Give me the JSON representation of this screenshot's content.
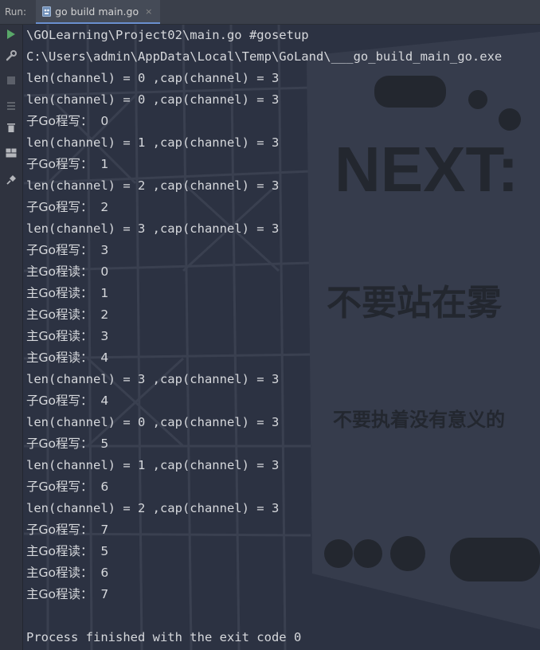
{
  "run_panel": {
    "label": "Run:",
    "tab": {
      "label": "go build main.go",
      "icon": "go-file-icon",
      "close": "×"
    }
  },
  "sidebar": {
    "tools": [
      "run-icon",
      "wrench-icon",
      "stop-icon",
      "sort-icon",
      "trash-icon",
      "layout-icon",
      "pin-icon"
    ]
  },
  "colors": {
    "run_green": "#59a869",
    "text": "#d6d8dc",
    "tab_underline": "#6a8fd0"
  },
  "console": {
    "lines": [
      "\\GOLearning\\Project02\\main.go #gosetup",
      "C:\\Users\\admin\\AppData\\Local\\Temp\\GoLand\\___go_build_main_go.exe",
      "len(channel) = 0 ,cap(channel) = 3",
      "len(channel) = 0 ,cap(channel) = 3",
      "子Go程写：  0",
      "len(channel) = 1 ,cap(channel) = 3",
      "子Go程写：  1",
      "len(channel) = 2 ,cap(channel) = 3",
      "子Go程写：  2",
      "len(channel) = 3 ,cap(channel) = 3",
      "子Go程写：  3",
      "主Go程读：  0",
      "主Go程读：  1",
      "主Go程读：  2",
      "主Go程读：  3",
      "主Go程读：  4",
      "len(channel) = 3 ,cap(channel) = 3",
      "子Go程写：  4",
      "len(channel) = 0 ,cap(channel) = 3",
      "子Go程写：  5",
      "len(channel) = 1 ,cap(channel) = 3",
      "子Go程写：  6",
      "len(channel) = 2 ,cap(channel) = 3",
      "子Go程写：  7",
      "主Go程读：  5",
      "主Go程读：  6",
      "主Go程读：  7",
      "",
      "Process finished with the exit code 0"
    ]
  }
}
